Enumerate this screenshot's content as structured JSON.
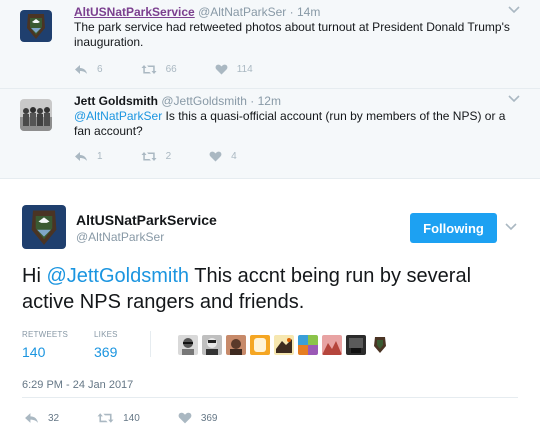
{
  "tweets": [
    {
      "name": "AltUSNatParkService",
      "handle": "@AltNatParkSer",
      "time": "14m",
      "text": "The park service had retweeted photos about turnout at President Donald Trump's inauguration.",
      "replies": "6",
      "retweets": "66",
      "likes": "114"
    },
    {
      "name": "Jett Goldsmith",
      "handle": "@JettGoldsmith",
      "time": "12m",
      "mention": "@AltNatParkSer",
      "text": " Is this a quasi-official account (run by members of the NPS) or a fan account?",
      "replies": "1",
      "retweets": "2",
      "likes": "4"
    }
  ],
  "separator": "·",
  "main": {
    "name": "AltUSNatParkService",
    "handle": "@AltNatParkSer",
    "follow_label": "Following",
    "text_prefix": "Hi ",
    "mention": "@JettGoldsmith",
    "text": " This accnt being run by several active NPS rangers and friends.",
    "retweets_label": "RETWEETS",
    "retweets_value": "140",
    "likes_label": "LIKES",
    "likes_value": "369",
    "timestamp": "6:29 PM - 24 Jan 2017",
    "replies": "32",
    "retweets": "140",
    "likes": "369"
  },
  "colors": {
    "link": "#1b95e0",
    "visited_name": "#7b3f8f",
    "follow_button": "#1da1f2",
    "muted": "#aab8c2",
    "nps_brown": "#4a3424",
    "nps_green": "#3a5a32"
  },
  "icons": [
    "nps-arrowhead-icon",
    "reply-icon",
    "retweet-icon",
    "heart-icon",
    "chevron-down-icon"
  ]
}
